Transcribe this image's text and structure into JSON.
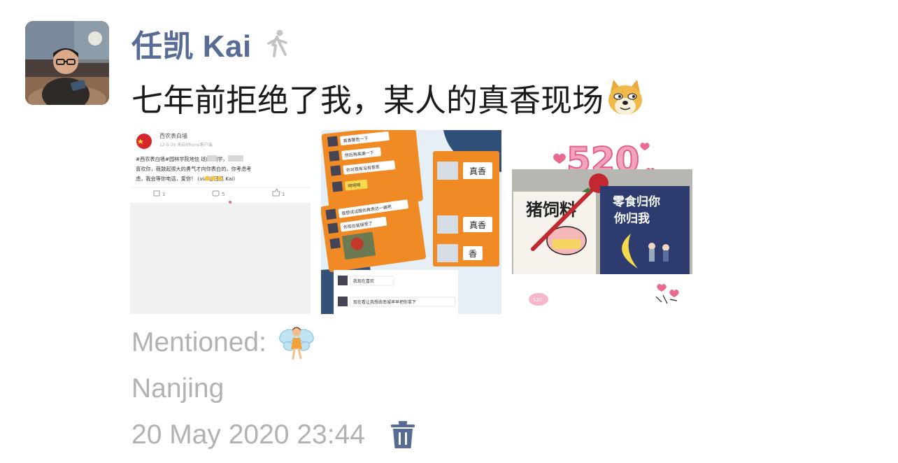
{
  "post": {
    "author": "任凯 Kai",
    "text": "七年前拒绝了我，某人的真香现场",
    "mention_label": "Mentioned:",
    "location": "Nanjing",
    "timestamp": "20 May 2020 23:44"
  },
  "photos": {
    "weibo": {
      "account_name": "西农表白墙",
      "date_line": "12-5-30 来自iPhone客户端",
      "line1": "#西农表白墙#园林学院地信      班的        同学，我",
      "line2": "喜欢你，我鼓起很大的勇气才向你表白的，你考虑考",
      "line3": "虑，我会等你电话，爱你！      (via:@任凯 Kai)",
      "repost_count": "1",
      "comment_count": "5",
      "like_count": "1"
    },
    "chat": {
      "b1": "真香警告一下",
      "b2": "然后再高潮一下",
      "b3": "你对我有没有意思",
      "b4": "呵呵呵",
      "b5": "我想试试跟你再表达一遍吧",
      "b6": "你现在能接受了",
      "b7": "真香",
      "b8": "真香",
      "b9": "香",
      "b10": "我现在喜欢",
      "b11": "现在看让我想去南城早早把你拿下"
    },
    "card": {
      "number": "520",
      "left_text": "猪饲料",
      "right_line1": "零食归你",
      "right_line2": "你归我",
      "badge": "520"
    }
  },
  "colors": {
    "author_link": "#576b95",
    "meta_gray": "#b2b2b2",
    "orange": "#f08a24",
    "pink": "#e86a8e"
  },
  "icons": {
    "status": "walking-person-icon",
    "emoji": "doge-emoji-icon",
    "mention": "fairy-emoji-icon",
    "delete": "trash-icon"
  }
}
